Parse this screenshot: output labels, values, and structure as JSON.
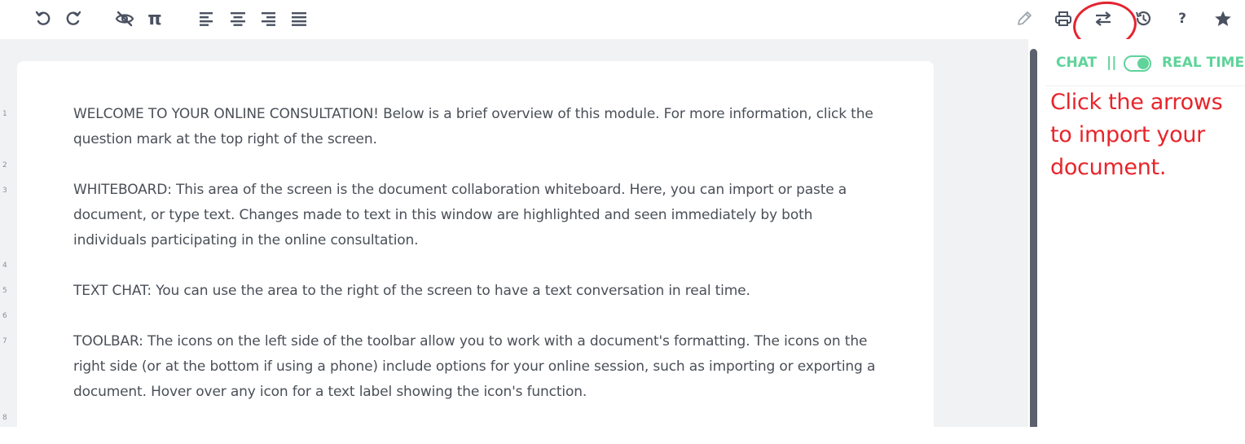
{
  "toolbar": {
    "left_icons": [
      "undo-icon",
      "redo-icon",
      "hide-changes-icon",
      "pi-symbol-icon",
      "align-left-icon",
      "align-center-icon",
      "align-right-icon",
      "align-justify-icon"
    ],
    "pi_glyph": "π",
    "right_icons": [
      "pencil-icon",
      "print-icon",
      "import-export-arrows-icon",
      "history-icon",
      "help-icon",
      "star-icon"
    ],
    "help_glyph": "?"
  },
  "line_numbers": [
    "1",
    "2",
    "3",
    "4",
    "5",
    "6",
    "7",
    "8"
  ],
  "document": {
    "paragraphs": [
      "WELCOME TO YOUR ONLINE CONSULTATION! Below is a brief overview of this module. For more information, click the question mark at the top right of the screen.",
      "WHITEBOARD: This area of the screen is the document collaboration whiteboard. Here, you can import or paste a document, or type text. Changes made to text in this window are highlighted and seen immediately by both individuals participating in the online consultation.",
      "TEXT CHAT: You can use the area to the right of the screen to have a text conversation in real time.",
      "TOOLBAR: The icons on the left side of the toolbar allow you to work with a document's formatting. The icons on the right side (or at the bottom if using a phone) include options for your online session, such as importing or exporting a document. Hover over any icon for a text label showing the icon's function."
    ]
  },
  "sidebar": {
    "chat_label": "CHAT",
    "separator": "||",
    "realtime_label": "REAL TIME",
    "toggle_on": true
  },
  "annotation": {
    "note_text": "Click the arrows to import your document."
  },
  "colors": {
    "accent_green": "#5fd39a",
    "annotation_red": "#e32430",
    "icon_dark": "#4a5261"
  }
}
